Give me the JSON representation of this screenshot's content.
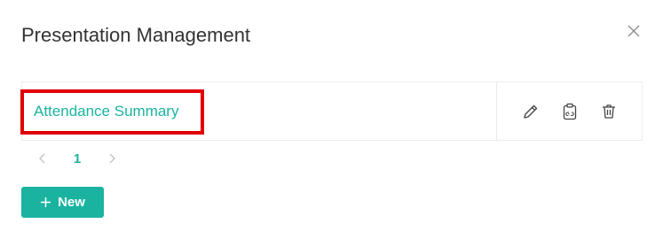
{
  "modal": {
    "title": "Presentation Management",
    "close_icon": "close-icon"
  },
  "table": {
    "rows": [
      {
        "name": "Attendance Summary",
        "actions": [
          "edit-icon",
          "copy-link-icon",
          "delete-icon"
        ]
      }
    ]
  },
  "pagination": {
    "current_page": "1",
    "prev_icon": "chevron-left-icon",
    "next_icon": "chevron-right-icon"
  },
  "new_button": {
    "label": "New",
    "icon": "plus-icon"
  },
  "colors": {
    "accent": "#1ab3a0",
    "highlight": "#e00000",
    "border": "#ebebeb"
  }
}
